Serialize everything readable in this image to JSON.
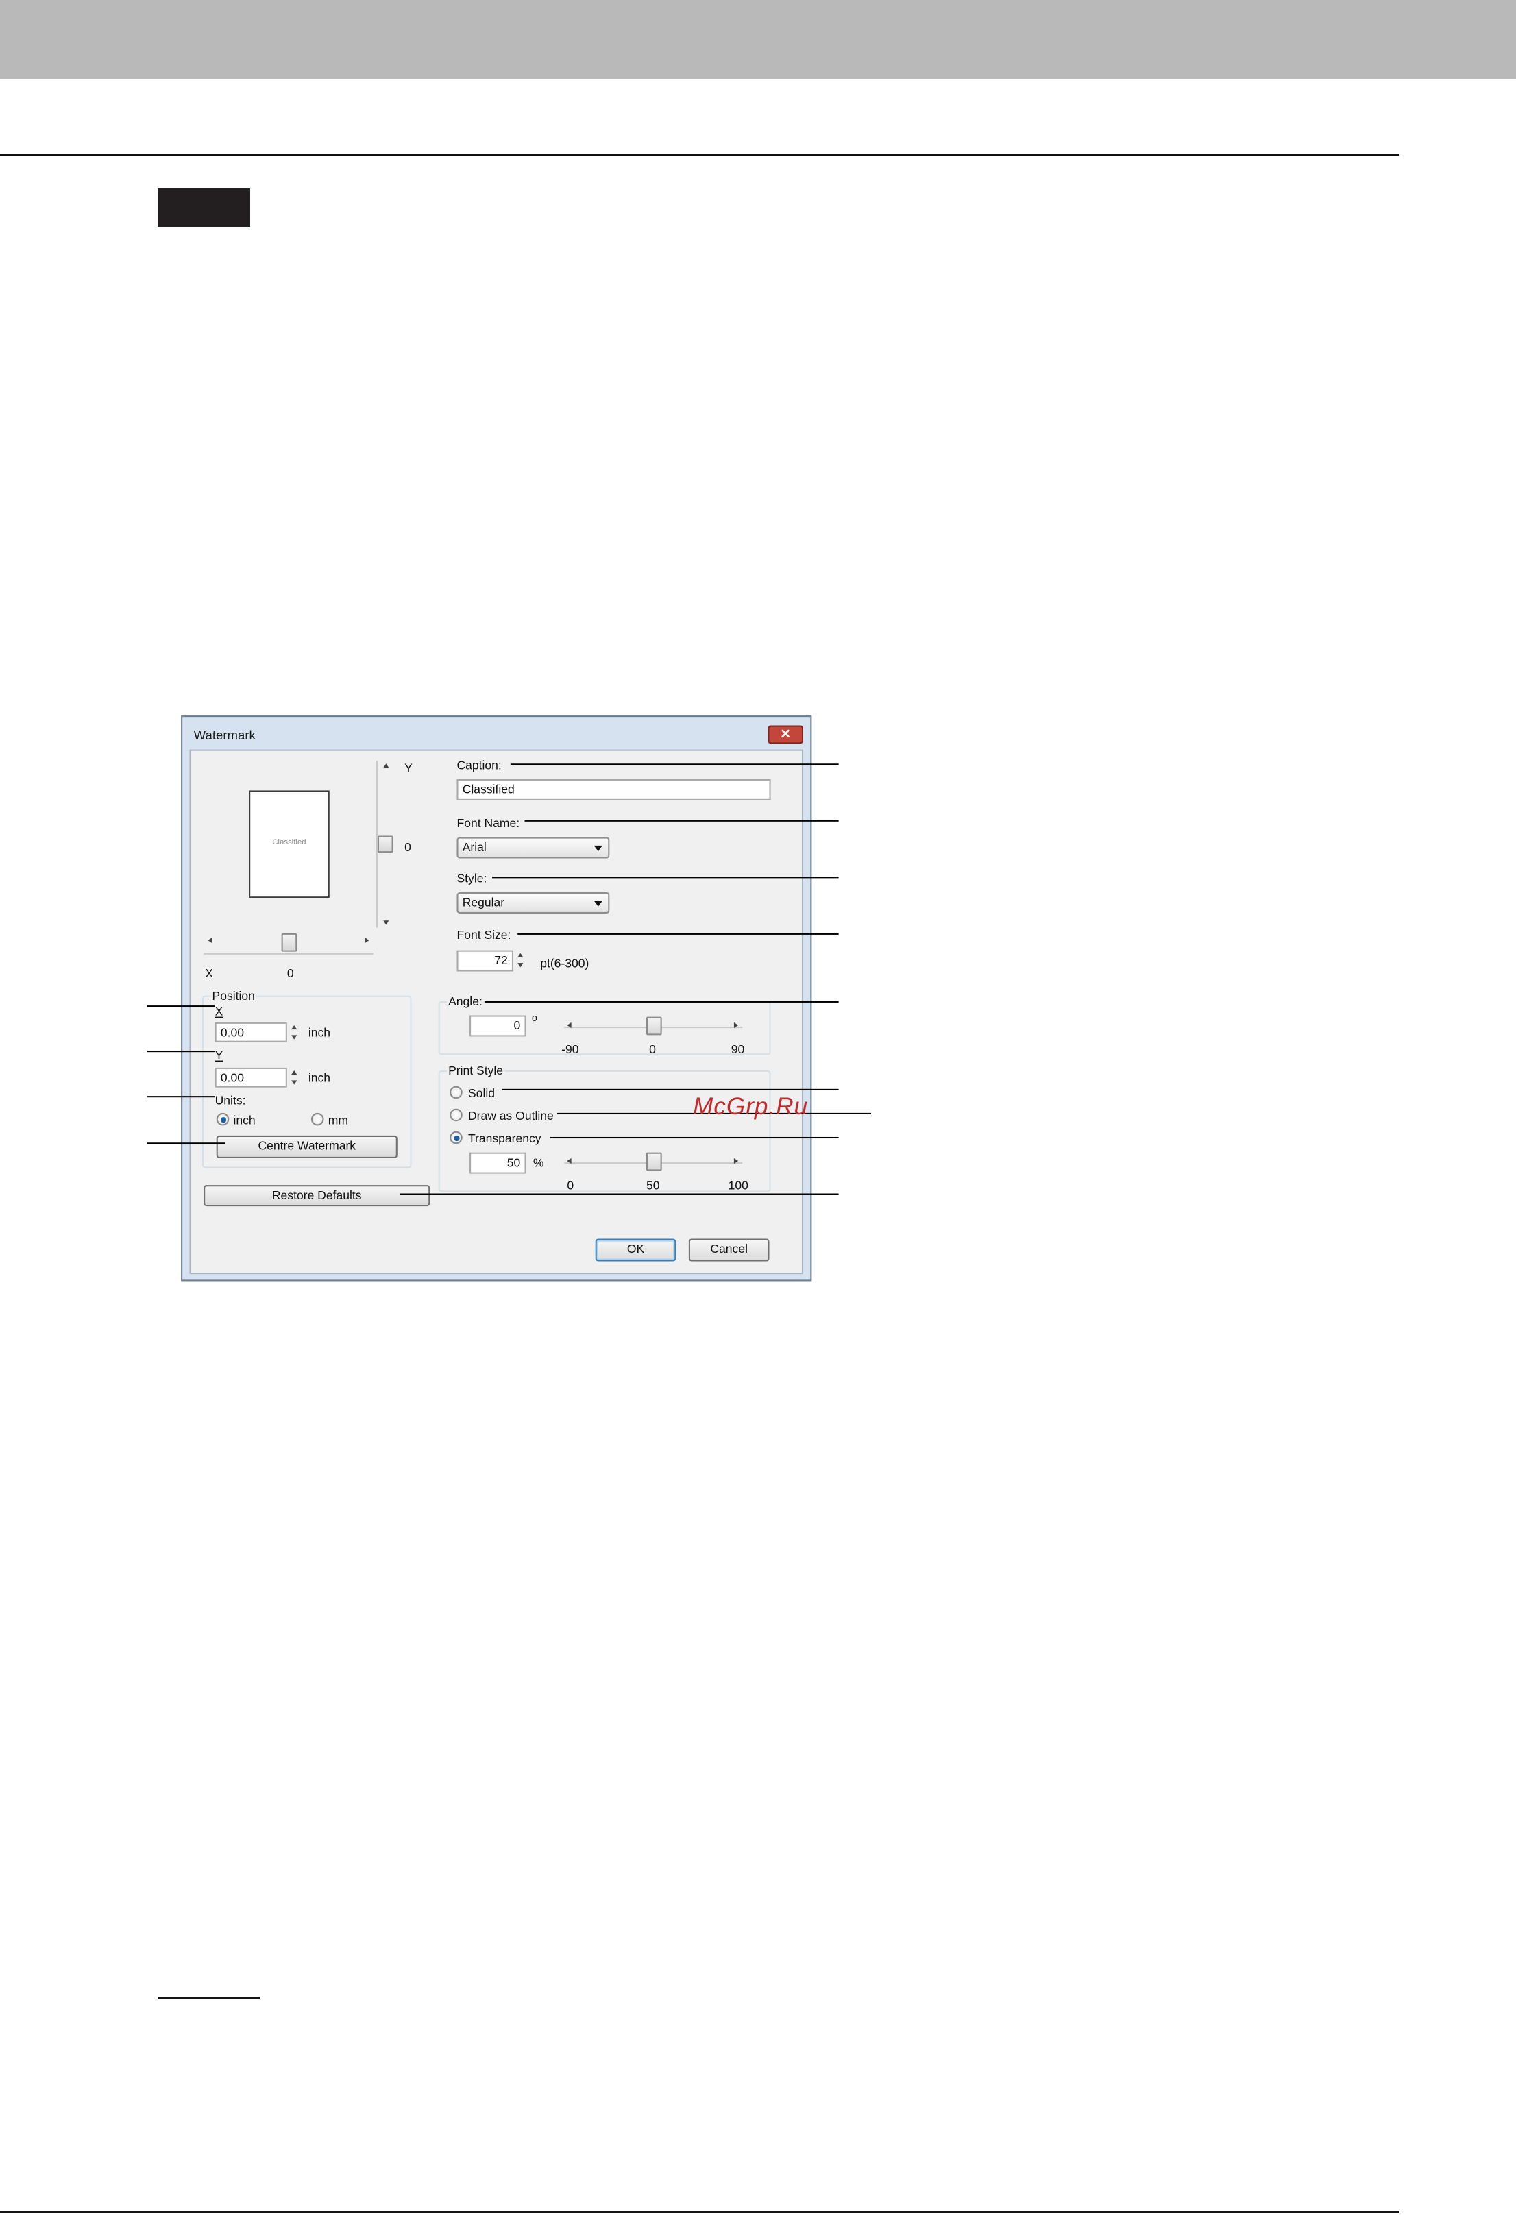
{
  "dialog": {
    "title": "Watermark",
    "close_glyph": "✕",
    "preview": {
      "caption_sample": "Classified",
      "y_axis_label": "Y",
      "y_value": "0",
      "x_axis_label": "X",
      "x_value": "0"
    },
    "position": {
      "group_label": "Position",
      "x_label": "X",
      "x_value": "0.00",
      "x_unit": "inch",
      "y_label": "Y",
      "y_value": "0.00",
      "y_unit": "inch",
      "units_label": "Units:",
      "unit_options": [
        "inch",
        "mm"
      ],
      "unit_selected": "inch",
      "centre_button": "Centre Watermark"
    },
    "restore_button": "Restore Defaults",
    "caption": {
      "label": "Caption:",
      "value": "Classified"
    },
    "font_name": {
      "label": "Font Name:",
      "value": "Arial"
    },
    "style": {
      "label": "Style:",
      "value": "Regular"
    },
    "font_size": {
      "label": "Font Size:",
      "value": "72",
      "range_hint": "pt(6-300)"
    },
    "angle": {
      "label": "Angle:",
      "value": "0",
      "unit": "o",
      "ticks": [
        "-90",
        "0",
        "90"
      ],
      "slider_fraction": 0.5
    },
    "print_style": {
      "group_label": "Print Style",
      "options": [
        "Solid",
        "Draw as Outline",
        "Transparency"
      ],
      "selected": "Transparency",
      "transparency_value": "50",
      "transparency_unit": "%",
      "ticks": [
        "0",
        "50",
        "100"
      ],
      "slider_fraction": 0.5
    },
    "ok_button": "OK",
    "cancel_button": "Cancel"
  },
  "site_watermark": "McGrp.Ru",
  "icons": [
    "close-icon",
    "chevron-down-icon",
    "spin-up-icon",
    "spin-down-icon",
    "scroll-left-icon",
    "scroll-right-icon",
    "scroll-up-icon",
    "scroll-down-icon",
    "radio-icon"
  ]
}
